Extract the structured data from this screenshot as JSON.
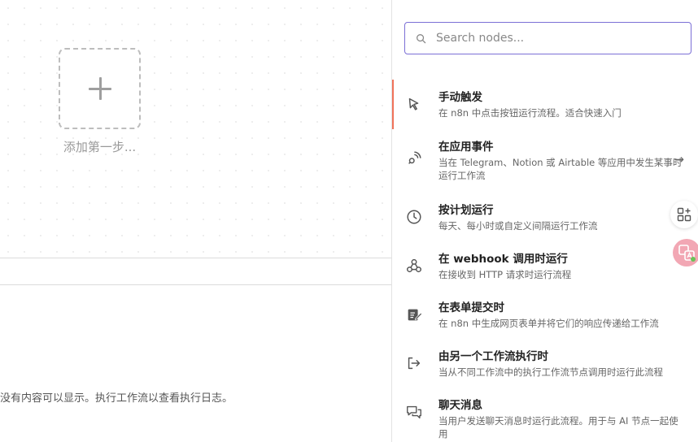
{
  "canvas": {
    "add_step_label": "添加第一步..."
  },
  "logs": {
    "empty_message": "前还没有内容可以显示。执行工作流以查看执行日志。"
  },
  "search": {
    "placeholder": "Search nodes...",
    "value": ""
  },
  "nodes": [
    {
      "icon": "cursor-icon",
      "title": "手动触发",
      "description": "在 n8n 中点击按钮运行流程。适合快速入门",
      "active": true
    },
    {
      "icon": "satellite-icon",
      "title": "在应用事件",
      "description": "当在 Telegram、Notion 或 Airtable 等应用中发生某事时运行工作流",
      "has_arrow": true
    },
    {
      "icon": "clock-icon",
      "title": "按计划运行",
      "description": "每天、每小时或自定义间隔运行工作流"
    },
    {
      "icon": "webhook-icon",
      "title": "在 webhook 调用时运行",
      "description": "在接收到 HTTP 请求时运行流程"
    },
    {
      "icon": "form-icon",
      "title": "在表单提交时",
      "description": "在 n8n 中生成网页表单并将它们的响应传递给工作流"
    },
    {
      "icon": "sign-in-icon",
      "title": "由另一个工作流执行时",
      "description": "当从不同工作流中的执行工作流节点调用时运行此流程"
    },
    {
      "icon": "chat-icon",
      "title": "聊天消息",
      "description": "当用户发送聊天消息时运行此流程。用于与 AI 节点一起使用"
    }
  ],
  "colors": {
    "accent": "#f0735a",
    "search_border": "#7b6fd6"
  }
}
